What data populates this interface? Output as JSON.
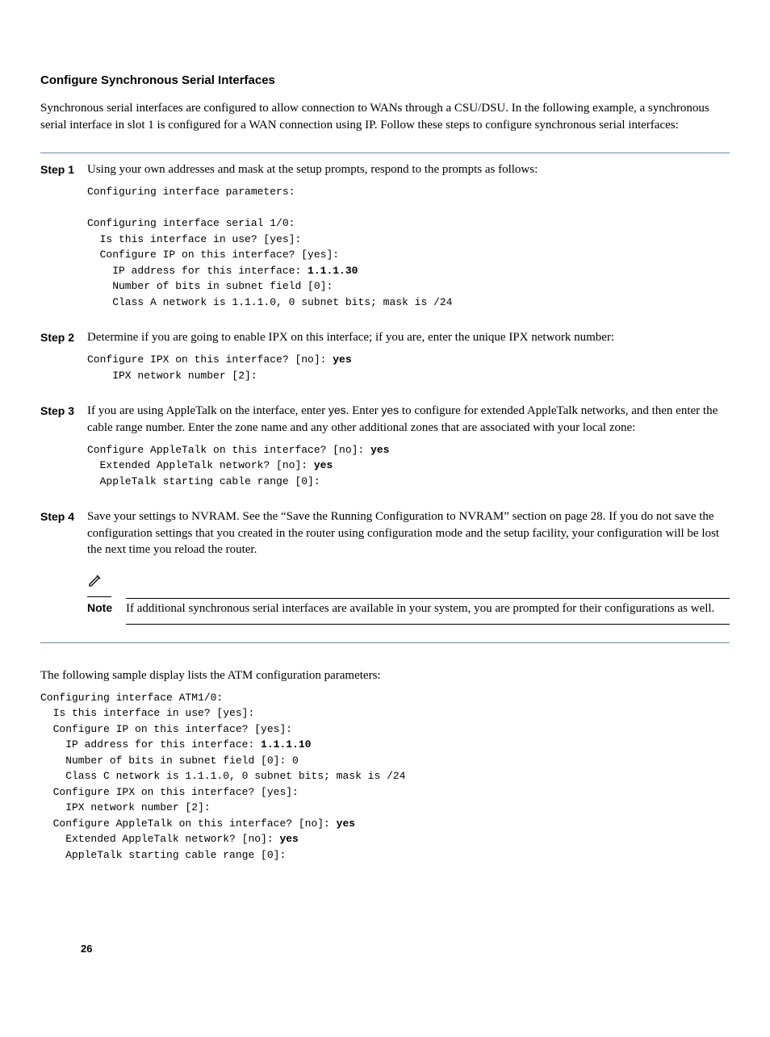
{
  "section_title": "Configure Synchronous Serial Interfaces",
  "intro": "Synchronous serial interfaces are configured to allow connection to WANs through a CSU/DSU. In the following example, a synchronous serial interface in slot 1 is configured for a WAN connection using IP. Follow these steps to configure synchronous serial interfaces:",
  "steps": [
    {
      "label": "Step 1",
      "text": "Using your own addresses and mask at the setup prompts, respond to the prompts as follows:",
      "code_lines": [
        {
          "t": "Configuring interface parameters:"
        },
        {
          "t": ""
        },
        {
          "t": "Configuring interface serial 1/0:"
        },
        {
          "t": "  Is this interface in use? [yes]:"
        },
        {
          "t": "  Configure IP on this interface? [yes]:"
        },
        {
          "t": "    IP address for this interface: ",
          "b": "1.1.1.30"
        },
        {
          "t": "    Number of bits in subnet field [0]:"
        },
        {
          "t": "    Class A network is 1.1.1.0, 0 subnet bits; mask is /24"
        }
      ]
    },
    {
      "label": "Step 2",
      "text": "Determine if you are going to enable IPX on this interface; if you are, enter the unique IPX network number:",
      "code_lines": [
        {
          "t": "Configure IPX on this interface? [no]: ",
          "b": "yes"
        },
        {
          "t": "    IPX network number [2]:"
        }
      ]
    },
    {
      "label": "Step 3",
      "text_segments": [
        "If you are using AppleTalk on the interface, enter ",
        {
          "sans": "yes"
        },
        ". Enter ",
        {
          "sans": "yes"
        },
        " to configure for extended AppleTalk networks, and then enter the cable range number. Enter the zone name and any other additional zones that are associated with your local zone:"
      ],
      "code_lines": [
        {
          "t": "Configure AppleTalk on this interface? [no]: ",
          "b": "yes"
        },
        {
          "t": "  Extended AppleTalk network? [no]: ",
          "b": "yes"
        },
        {
          "t": "  AppleTalk starting cable range [0]:"
        }
      ]
    },
    {
      "label": "Step 4",
      "text": "Save your settings to NVRAM. See the “Save the Running Configuration to NVRAM” section on page 28. If you do not save the configuration settings that you created in the router using configuration mode and the setup facility, your configuration will be lost the next time you reload the router.",
      "note": {
        "label": "Note",
        "text": "If additional synchronous serial interfaces are available in your system, you are prompted for their configurations as well."
      }
    }
  ],
  "sample_intro": "The following sample display lists the ATM configuration parameters:",
  "sample_code_lines": [
    {
      "t": "Configuring interface ATM1/0:"
    },
    {
      "t": "  Is this interface in use? [yes]:"
    },
    {
      "t": "  Configure IP on this interface? [yes]:"
    },
    {
      "t": "    IP address for this interface: ",
      "b": "1.1.1.10"
    },
    {
      "t": "    Number of bits in subnet field [0]: 0"
    },
    {
      "t": "    Class C network is 1.1.1.0, 0 subnet bits; mask is /24"
    },
    {
      "t": "  Configure IPX on this interface? [yes]:"
    },
    {
      "t": "    IPX network number [2]:"
    },
    {
      "t": "  Configure AppleTalk on this interface? [no]: ",
      "b": "yes"
    },
    {
      "t": "    Extended AppleTalk network? [no]: ",
      "b": "yes"
    },
    {
      "t": "    AppleTalk starting cable range [0]:"
    }
  ],
  "page_number": "26"
}
